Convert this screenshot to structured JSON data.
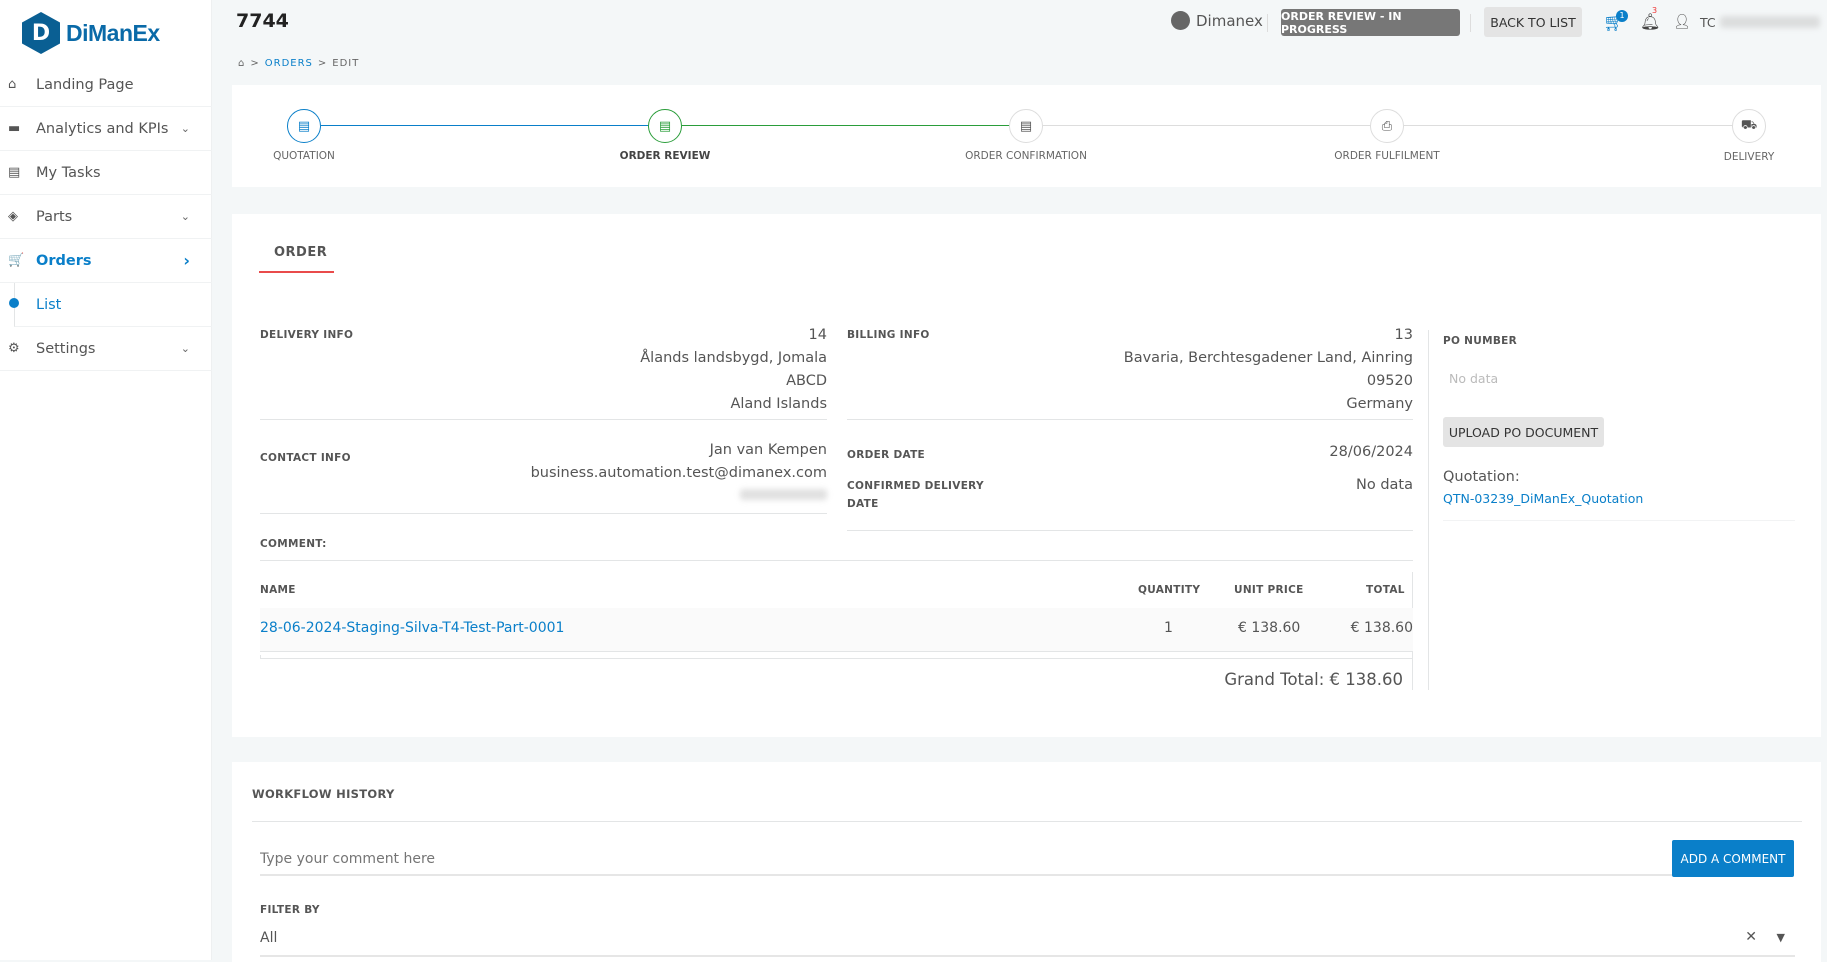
{
  "brand": {
    "logo_letter": "D",
    "name": "DiManEx"
  },
  "sidebar": {
    "items": [
      {
        "label": "Landing Page",
        "icon": "home-icon",
        "glyph": "⌂"
      },
      {
        "label": "Analytics and KPIs",
        "icon": "briefcase-icon",
        "glyph": "▬",
        "chevron": "⌄"
      },
      {
        "label": "My Tasks",
        "icon": "clipboard-icon",
        "glyph": "▤"
      },
      {
        "label": "Parts",
        "icon": "layers-icon",
        "glyph": "◈",
        "chevron": "⌄"
      },
      {
        "label": "Orders",
        "icon": "cart-icon",
        "glyph": "🛒",
        "chevron": "›",
        "active": true
      },
      {
        "label": "List",
        "sub": true,
        "active": true
      },
      {
        "label": "Settings",
        "icon": "gear-icon",
        "glyph": "⚙",
        "chevron": "⌄"
      }
    ]
  },
  "header": {
    "title": "7744",
    "user_org": "Dimanex",
    "status": "ORDER REVIEW - IN PROGRESS",
    "back": "BACK TO LIST",
    "cart_count": "1",
    "notif_count": "3",
    "user_initials": "TC"
  },
  "breadcrumb": {
    "orders": "ORDERS",
    "edit": "EDIT",
    "sep": ">"
  },
  "stepper": {
    "steps": [
      {
        "label": "QUOTATION",
        "state": "done"
      },
      {
        "label": "ORDER REVIEW",
        "state": "current"
      },
      {
        "label": "ORDER CONFIRMATION",
        "state": "pending"
      },
      {
        "label": "ORDER FULFILMENT",
        "state": "pending"
      },
      {
        "label": "DELIVERY",
        "state": "pending"
      }
    ]
  },
  "order": {
    "tab": "ORDER",
    "delivery": {
      "label": "DELIVERY INFO",
      "lines": [
        "14",
        "Ålands landsbygd, Jomala",
        "ABCD",
        "Aland Islands"
      ]
    },
    "contact": {
      "label": "CONTACT INFO",
      "name": "Jan van Kempen",
      "email": "business.automation.test@dimanex.com"
    },
    "comment_label": "COMMENT:",
    "billing": {
      "label": "BILLING INFO",
      "lines": [
        "13",
        "Bavaria, Berchtesgadener Land, Ainring",
        "09520",
        "Germany"
      ]
    },
    "order_date": {
      "label": "ORDER DATE",
      "value": "28/06/2024"
    },
    "confirmed_delivery": {
      "label": "CONFIRMED DELIVERY DATE",
      "value": "No data"
    },
    "po": {
      "label": "PO NUMBER",
      "value": "No data",
      "upload": "UPLOAD PO DOCUMENT",
      "quotation_label": "Quotation:",
      "quotation_link": "QTN-03239_DiManEx_Quotation"
    },
    "table": {
      "headers": [
        "NAME",
        "QUANTITY",
        "UNIT PRICE",
        "TOTAL"
      ],
      "rows": [
        {
          "name": "28-06-2024-Staging-Silva-T4-Test-Part-0001",
          "quantity": "1",
          "unit_price": "€ 138.60",
          "total": "€ 138.60"
        }
      ]
    },
    "grand_total": "Grand Total: € 138.60"
  },
  "workflow": {
    "title": "WORKFLOW HISTORY",
    "comment_placeholder": "Type your comment here",
    "add_comment": "ADD A COMMENT",
    "filter_label": "FILTER BY",
    "filter_value": "All"
  },
  "colors": {
    "accent": "#0a7fc9",
    "success": "#2a9d3a",
    "tab_underline": "#e94b4b",
    "status_bg": "#777777"
  }
}
